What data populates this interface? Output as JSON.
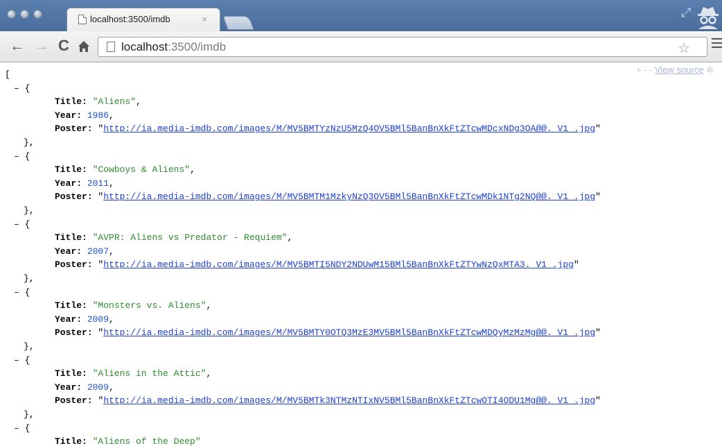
{
  "tab": {
    "title": "localhost:3500/imdb",
    "close_glyph": "×"
  },
  "address": {
    "host": "localhost",
    "path": ":3500/imdb"
  },
  "viewer": {
    "controls": "+ -",
    "view_source": "View source"
  },
  "json": {
    "open_bracket": "[",
    "collapse_marker": "– {",
    "close_marker": "},",
    "key_title": "Title:",
    "key_year": "Year:",
    "key_poster": "Poster:",
    "items": [
      {
        "title": "\"Aliens\"",
        "year": "1986",
        "poster": "http://ia.media-imdb.com/images/M/MV5BMTYzNzU5MzQ4OV5BMl5BanBnXkFtZTcwMDcxNDg3OA@@._V1_.jpg"
      },
      {
        "title": "\"Cowboys & Aliens\"",
        "year": "2011",
        "poster": "http://ia.media-imdb.com/images/M/MV5BMTM1MzkyNzQ3OV5BMl5BanBnXkFtZTcwMDk1NTg2NQ@@._V1_.jpg"
      },
      {
        "title": "\"AVPR: Aliens vs Predator - Requiem\"",
        "year": "2007",
        "poster": "http://ia.media-imdb.com/images/M/MV5BMTI5NDY2NDUwM15BMl5BanBnXkFtZTYwNzQxMTA3._V1_.jpg"
      },
      {
        "title": "\"Monsters vs. Aliens\"",
        "year": "2009",
        "poster": "http://ia.media-imdb.com/images/M/MV5BMTY0OTQ3MzE3MV5BMl5BanBnXkFtZTcwMDQyMzMzMg@@._V1_.jpg"
      },
      {
        "title": "\"Aliens in the Attic\"",
        "year": "2009",
        "poster": "http://ia.media-imdb.com/images/M/MV5BMTk3NTMzNTIxNV5BMl5BanBnXkFtZTcwOTI4ODU1Mg@@._V1_.jpg"
      },
      {
        "title": "\"Aliens of the Deep\""
      }
    ]
  },
  "icons": [
    "back-arrow-icon",
    "forward-arrow-icon",
    "reload-icon",
    "home-icon",
    "page-icon",
    "star-icon",
    "menu-icon",
    "incognito-icon",
    "resize-icon",
    "gear-icon"
  ]
}
